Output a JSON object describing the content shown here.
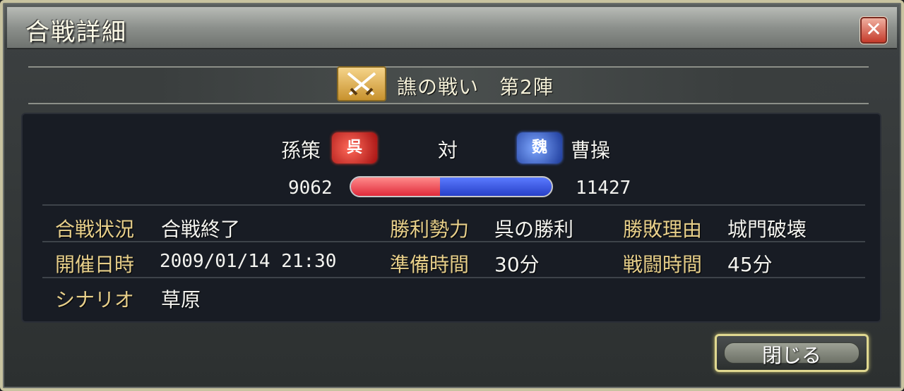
{
  "window": {
    "title": "合戦詳細",
    "close_icon": "close-icon"
  },
  "battle": {
    "name": "譙の戦い　第2陣",
    "icon": "crossed-swords-icon"
  },
  "matchup": {
    "left_name": "孫策",
    "left_faction": "呉",
    "left_color": "#d01a2a",
    "versus": "対",
    "right_faction": "魏",
    "right_name": "曹操",
    "right_color": "#2a4ad0",
    "left_power": "9062",
    "right_power": "11427",
    "left_share": 0.442
  },
  "details": {
    "status_label": "合戦状況",
    "status_value": "合戦終了",
    "winner_label": "勝利勢力",
    "winner_value": "呉の勝利",
    "reason_label": "勝敗理由",
    "reason_value": "城門破壊",
    "date_label": "開催日時",
    "date_value": "2009/01/14 21:30",
    "prep_label": "準備時間",
    "prep_value": "30分",
    "battle_time_label": "戦闘時間",
    "battle_time_value": "45分",
    "scenario_label": "シナリオ",
    "scenario_value": "草原"
  },
  "actions": {
    "close_label": "閉じる"
  }
}
